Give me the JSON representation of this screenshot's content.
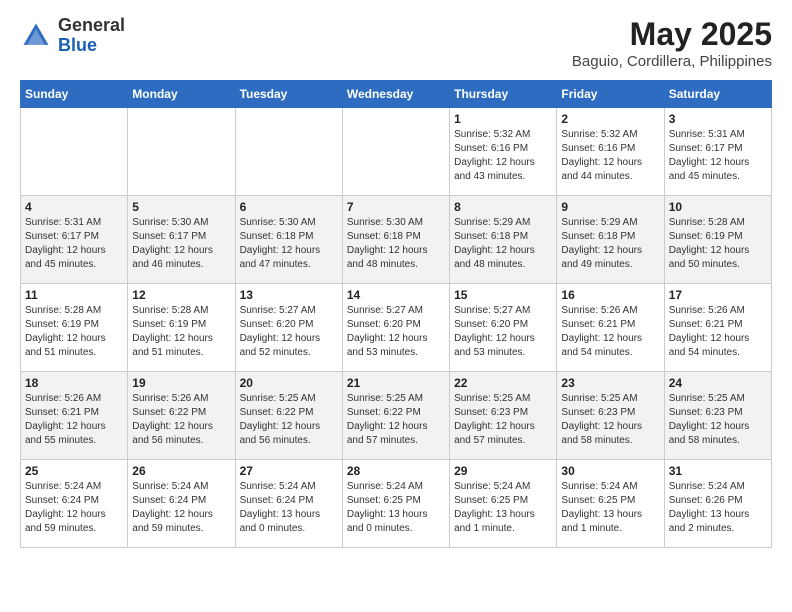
{
  "logo": {
    "general": "General",
    "blue": "Blue"
  },
  "title": "May 2025",
  "subtitle": "Baguio, Cordillera, Philippines",
  "days_header": [
    "Sunday",
    "Monday",
    "Tuesday",
    "Wednesday",
    "Thursday",
    "Friday",
    "Saturday"
  ],
  "weeks": [
    [
      {
        "day": "",
        "info": ""
      },
      {
        "day": "",
        "info": ""
      },
      {
        "day": "",
        "info": ""
      },
      {
        "day": "",
        "info": ""
      },
      {
        "day": "1",
        "info": "Sunrise: 5:32 AM\nSunset: 6:16 PM\nDaylight: 12 hours\nand 43 minutes."
      },
      {
        "day": "2",
        "info": "Sunrise: 5:32 AM\nSunset: 6:16 PM\nDaylight: 12 hours\nand 44 minutes."
      },
      {
        "day": "3",
        "info": "Sunrise: 5:31 AM\nSunset: 6:17 PM\nDaylight: 12 hours\nand 45 minutes."
      }
    ],
    [
      {
        "day": "4",
        "info": "Sunrise: 5:31 AM\nSunset: 6:17 PM\nDaylight: 12 hours\nand 45 minutes."
      },
      {
        "day": "5",
        "info": "Sunrise: 5:30 AM\nSunset: 6:17 PM\nDaylight: 12 hours\nand 46 minutes."
      },
      {
        "day": "6",
        "info": "Sunrise: 5:30 AM\nSunset: 6:18 PM\nDaylight: 12 hours\nand 47 minutes."
      },
      {
        "day": "7",
        "info": "Sunrise: 5:30 AM\nSunset: 6:18 PM\nDaylight: 12 hours\nand 48 minutes."
      },
      {
        "day": "8",
        "info": "Sunrise: 5:29 AM\nSunset: 6:18 PM\nDaylight: 12 hours\nand 48 minutes."
      },
      {
        "day": "9",
        "info": "Sunrise: 5:29 AM\nSunset: 6:18 PM\nDaylight: 12 hours\nand 49 minutes."
      },
      {
        "day": "10",
        "info": "Sunrise: 5:28 AM\nSunset: 6:19 PM\nDaylight: 12 hours\nand 50 minutes."
      }
    ],
    [
      {
        "day": "11",
        "info": "Sunrise: 5:28 AM\nSunset: 6:19 PM\nDaylight: 12 hours\nand 51 minutes."
      },
      {
        "day": "12",
        "info": "Sunrise: 5:28 AM\nSunset: 6:19 PM\nDaylight: 12 hours\nand 51 minutes."
      },
      {
        "day": "13",
        "info": "Sunrise: 5:27 AM\nSunset: 6:20 PM\nDaylight: 12 hours\nand 52 minutes."
      },
      {
        "day": "14",
        "info": "Sunrise: 5:27 AM\nSunset: 6:20 PM\nDaylight: 12 hours\nand 53 minutes."
      },
      {
        "day": "15",
        "info": "Sunrise: 5:27 AM\nSunset: 6:20 PM\nDaylight: 12 hours\nand 53 minutes."
      },
      {
        "day": "16",
        "info": "Sunrise: 5:26 AM\nSunset: 6:21 PM\nDaylight: 12 hours\nand 54 minutes."
      },
      {
        "day": "17",
        "info": "Sunrise: 5:26 AM\nSunset: 6:21 PM\nDaylight: 12 hours\nand 54 minutes."
      }
    ],
    [
      {
        "day": "18",
        "info": "Sunrise: 5:26 AM\nSunset: 6:21 PM\nDaylight: 12 hours\nand 55 minutes."
      },
      {
        "day": "19",
        "info": "Sunrise: 5:26 AM\nSunset: 6:22 PM\nDaylight: 12 hours\nand 56 minutes."
      },
      {
        "day": "20",
        "info": "Sunrise: 5:25 AM\nSunset: 6:22 PM\nDaylight: 12 hours\nand 56 minutes."
      },
      {
        "day": "21",
        "info": "Sunrise: 5:25 AM\nSunset: 6:22 PM\nDaylight: 12 hours\nand 57 minutes."
      },
      {
        "day": "22",
        "info": "Sunrise: 5:25 AM\nSunset: 6:23 PM\nDaylight: 12 hours\nand 57 minutes."
      },
      {
        "day": "23",
        "info": "Sunrise: 5:25 AM\nSunset: 6:23 PM\nDaylight: 12 hours\nand 58 minutes."
      },
      {
        "day": "24",
        "info": "Sunrise: 5:25 AM\nSunset: 6:23 PM\nDaylight: 12 hours\nand 58 minutes."
      }
    ],
    [
      {
        "day": "25",
        "info": "Sunrise: 5:24 AM\nSunset: 6:24 PM\nDaylight: 12 hours\nand 59 minutes."
      },
      {
        "day": "26",
        "info": "Sunrise: 5:24 AM\nSunset: 6:24 PM\nDaylight: 12 hours\nand 59 minutes."
      },
      {
        "day": "27",
        "info": "Sunrise: 5:24 AM\nSunset: 6:24 PM\nDaylight: 13 hours\nand 0 minutes."
      },
      {
        "day": "28",
        "info": "Sunrise: 5:24 AM\nSunset: 6:25 PM\nDaylight: 13 hours\nand 0 minutes."
      },
      {
        "day": "29",
        "info": "Sunrise: 5:24 AM\nSunset: 6:25 PM\nDaylight: 13 hours\nand 1 minute."
      },
      {
        "day": "30",
        "info": "Sunrise: 5:24 AM\nSunset: 6:25 PM\nDaylight: 13 hours\nand 1 minute."
      },
      {
        "day": "31",
        "info": "Sunrise: 5:24 AM\nSunset: 6:26 PM\nDaylight: 13 hours\nand 2 minutes."
      }
    ]
  ]
}
